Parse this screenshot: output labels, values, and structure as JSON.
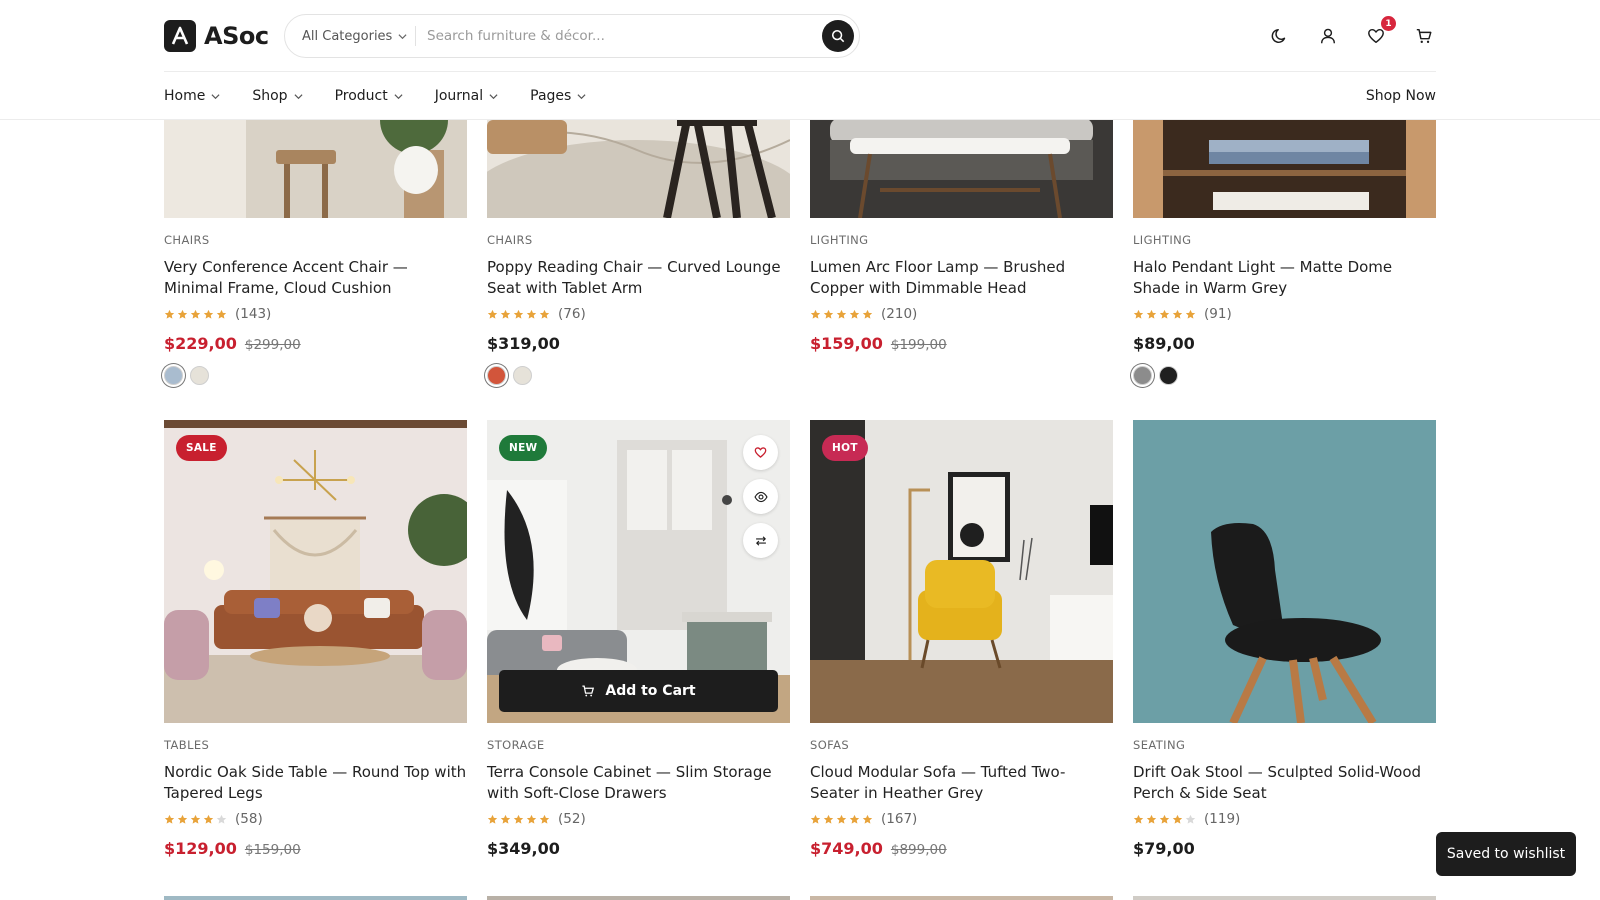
{
  "brand": {
    "name": "ASoc",
    "logo_letter": "A"
  },
  "search": {
    "category": "All Categories",
    "placeholder": "Search furniture & décor..."
  },
  "header_icons": {
    "theme": "moon-icon",
    "account": "user-icon",
    "wishlist": "heart-icon",
    "wishlist_count": "1",
    "cart": "cart-icon"
  },
  "nav": {
    "items": [
      {
        "label": "Home"
      },
      {
        "label": "Shop"
      },
      {
        "label": "Product"
      },
      {
        "label": "Journal"
      },
      {
        "label": "Pages"
      }
    ],
    "cta": "Shop Now"
  },
  "colors": {
    "sale_price": "#c8202f",
    "badge_sale": "#c8202f",
    "badge_new": "#1f7a3a",
    "badge_hot": "#c72a54",
    "star": "#e8a33a",
    "dark": "#1d1d1d"
  },
  "products_row1": [
    {
      "category": "CHAIRS",
      "title": "Very Conference Accent Chair — Minimal Frame, Cloud Cushion",
      "rating": 5,
      "reviews": "(143)",
      "price": "$229,00",
      "old_price": "$299,00",
      "on_sale": true,
      "swatches": [
        "#a9bccf",
        "#e6e2d9"
      ]
    },
    {
      "category": "CHAIRS",
      "title": "Poppy Reading Chair — Curved Lounge Seat with Tablet Arm",
      "rating": 5,
      "reviews": "(76)",
      "price": "$319,00",
      "old_price": "",
      "on_sale": false,
      "swatches": [
        "#d2553b",
        "#e6e2d9"
      ]
    },
    {
      "category": "LIGHTING",
      "title": "Lumen Arc Floor Lamp — Brushed Copper with Dimmable Head",
      "rating": 5,
      "reviews": "(210)",
      "price": "$159,00",
      "old_price": "$199,00",
      "on_sale": true,
      "swatches": []
    },
    {
      "category": "LIGHTING",
      "title": "Halo Pendant Light — Matte Dome Shade in Warm Grey",
      "rating": 5,
      "reviews": "(91)",
      "price": "$89,00",
      "old_price": "",
      "on_sale": false,
      "swatches": [
        "#8c8c8c",
        "#1f1f1f"
      ]
    }
  ],
  "products_row2": [
    {
      "badge": "SALE",
      "category": "TABLES",
      "title": "Nordic Oak Side Table — Round Top with Tapered Legs",
      "rating": 4,
      "reviews": "(58)",
      "price": "$129,00",
      "old_price": "$159,00",
      "on_sale": true
    },
    {
      "badge": "NEW",
      "category": "STORAGE",
      "title": "Terra Console Cabinet — Slim Storage with Soft-Close Drawers",
      "rating": 5,
      "reviews": "(52)",
      "price": "$349,00",
      "old_price": "",
      "on_sale": false,
      "add_to_cart": "Add to Cart"
    },
    {
      "badge": "HOT",
      "category": "SOFAS",
      "title": "Cloud Modular Sofa — Tufted Two-Seater in Heather Grey",
      "rating": 5,
      "reviews": "(167)",
      "price": "$749,00",
      "old_price": "$899,00",
      "on_sale": true
    },
    {
      "badge": "",
      "category": "SEATING",
      "title": "Drift Oak Stool — Sculpted Solid-Wood Perch & Side Seat",
      "rating": 4,
      "reviews": "(119)",
      "price": "$79,00",
      "old_price": "",
      "on_sale": false
    }
  ],
  "toast": "Saved to wishlist"
}
